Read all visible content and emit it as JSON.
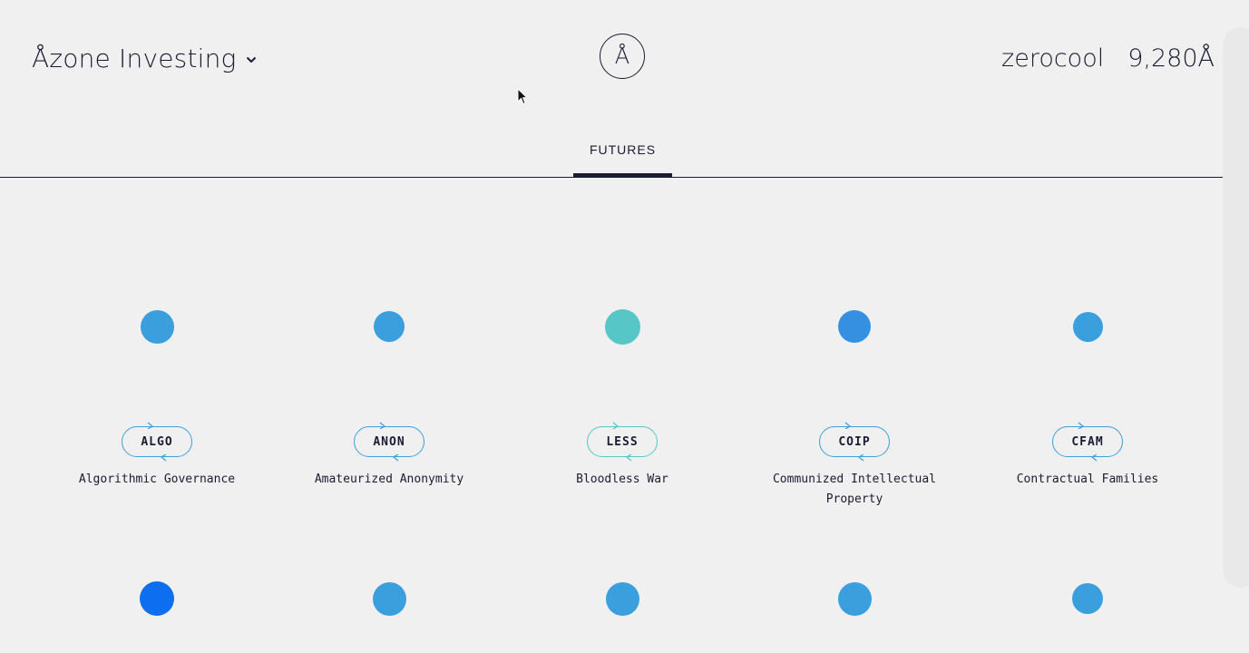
{
  "header": {
    "brand": "Åzone Investing",
    "logo_glyph": "Å",
    "username": "zerocool",
    "balance": "9,280Å"
  },
  "tabs": [
    {
      "label": "FUTURES",
      "active": true
    }
  ],
  "futures_row1": [
    {
      "ticker": "ALGO",
      "name": "Algorithmic Governance",
      "dot_color": "#3a9fdc",
      "accent": "#3d9fdc"
    },
    {
      "ticker": "ANON",
      "name": "Amateurized Anonymity",
      "dot_color": "#3a9fdc",
      "accent": "#3d9fdc"
    },
    {
      "ticker": "LESS",
      "name": "Bloodless War",
      "dot_color": "#56c6c6",
      "accent": "#56c6c6"
    },
    {
      "ticker": "COIP",
      "name": "Communized Intellectual Property",
      "dot_color": "#3590e2",
      "accent": "#3d9fdc"
    },
    {
      "ticker": "CFAM",
      "name": "Contractual Families",
      "dot_color": "#3a9fdc",
      "accent": "#3d9fdc"
    }
  ],
  "futures_row2": [
    {
      "dot_color": "#0e6ef0"
    },
    {
      "dot_color": "#3a9fdc"
    },
    {
      "dot_color": "#3a9fdc"
    },
    {
      "dot_color": "#3a9fdc"
    },
    {
      "dot_color": "#3a9fdc"
    }
  ]
}
